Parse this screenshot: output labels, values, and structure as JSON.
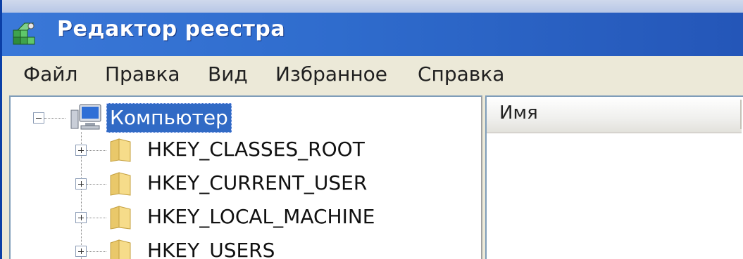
{
  "window": {
    "title": "Редактор реестра",
    "icon": "regedit-icon"
  },
  "menu": {
    "items": [
      {
        "label": "Файл"
      },
      {
        "label": "Правка"
      },
      {
        "label": "Вид"
      },
      {
        "label": "Избранное"
      },
      {
        "label": "Справка"
      }
    ]
  },
  "tree": {
    "root": {
      "label": "Компьютер",
      "icon": "computer-icon",
      "expanded": true,
      "selected": true
    },
    "keys": [
      {
        "label": "HKEY_CLASSES_ROOT",
        "icon": "folder-icon"
      },
      {
        "label": "HKEY_CURRENT_USER",
        "icon": "folder-icon"
      },
      {
        "label": "HKEY_LOCAL_MACHINE",
        "icon": "folder-icon"
      },
      {
        "label": "HKEY_USERS",
        "icon": "folder-icon"
      }
    ]
  },
  "list": {
    "columns": [
      {
        "label": "Имя"
      }
    ]
  },
  "colors": {
    "titlebar": "#2f6ccd",
    "selection": "#316ac5",
    "menubar": "#ece9d8"
  }
}
